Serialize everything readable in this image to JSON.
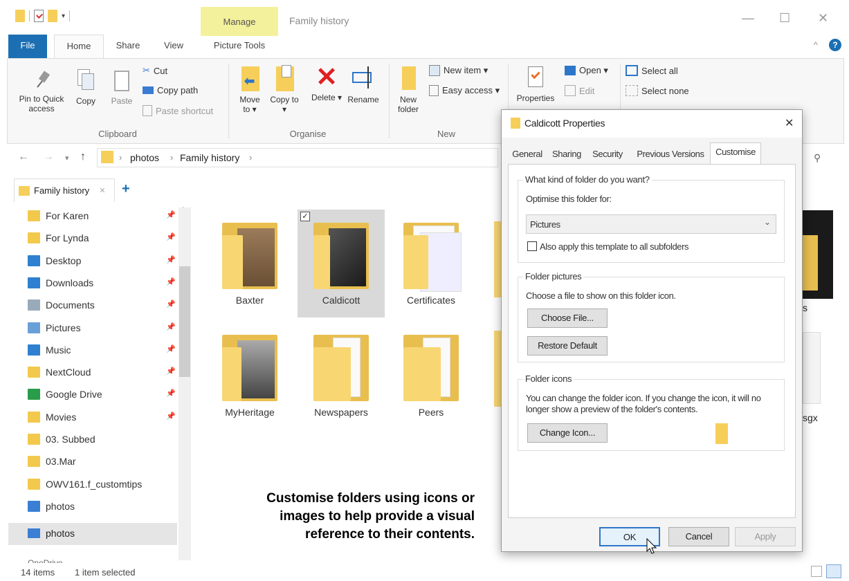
{
  "window": {
    "title": "Family history",
    "manage_tab": "Manage",
    "minimize": "—",
    "maximize": "☐",
    "close": "✕"
  },
  "tabs": {
    "file": "File",
    "home": "Home",
    "share": "Share",
    "view": "View",
    "picture_tools": "Picture Tools"
  },
  "ribbon": {
    "clipboard": {
      "pin": "Pin to Quick access",
      "copy": "Copy",
      "paste": "Paste",
      "cut": "Cut",
      "copy_path": "Copy path",
      "paste_shortcut": "Paste shortcut",
      "group": "Clipboard"
    },
    "organise": {
      "move_to": "Move to ▾",
      "copy_to": "Copy to ▾",
      "delete": "Delete ▾",
      "rename": "Rename",
      "group": "Organise"
    },
    "new": {
      "new_folder": "New folder",
      "new_item": "New item ▾",
      "easy_access": "Easy access ▾",
      "group": "New"
    },
    "open": {
      "properties": "Properties",
      "open": "Open ▾",
      "edit": "Edit"
    },
    "select": {
      "select_all": "Select all",
      "select_none": "Select none"
    }
  },
  "address": {
    "crumb1": "photos",
    "crumb2": "Family history",
    "sep": "›"
  },
  "quick_tab": {
    "label": "Family history",
    "close": "✕",
    "add": "+"
  },
  "sidebar": {
    "items": [
      {
        "label": "For Karen",
        "color": "#f2c94c",
        "pinned": "📌"
      },
      {
        "label": "For Lynda",
        "color": "#f2c94c",
        "pinned": "📌"
      },
      {
        "label": "Desktop",
        "color": "#2f80d0",
        "pinned": "📌"
      },
      {
        "label": "Downloads",
        "color": "#2f80d0",
        "pinned": "📌"
      },
      {
        "label": "Documents",
        "color": "#9ab",
        "pinned": "📌"
      },
      {
        "label": "Pictures",
        "color": "#6aa0d8",
        "pinned": "📌"
      },
      {
        "label": "Music",
        "color": "#2f80d0",
        "pinned": "📌"
      },
      {
        "label": "NextCloud",
        "color": "#f2c94c",
        "pinned": "📌"
      },
      {
        "label": "Google Drive",
        "color": "#2a9d4a",
        "pinned": "📌"
      },
      {
        "label": "Movies",
        "color": "#f2c94c",
        "pinned": "📌"
      },
      {
        "label": "03. Subbed",
        "color": "#f2c94c",
        "pinned": ""
      },
      {
        "label": "03.Mar",
        "color": "#f2c94c",
        "pinned": ""
      },
      {
        "label": "OWV161.f_customtips",
        "color": "#f2c94c",
        "pinned": ""
      },
      {
        "label": "photos",
        "color": "#3b7fd4",
        "pinned": ""
      }
    ],
    "section_photos": "photos",
    "onedrive_partial": "OneDrive"
  },
  "folders": [
    {
      "name": "Baxter"
    },
    {
      "name": "Caldicott"
    },
    {
      "name": "Certificates"
    },
    {
      "name": "MyHeritage"
    },
    {
      "name": "Newspapers"
    },
    {
      "name": "Peers"
    }
  ],
  "hidden_labels": {
    "partial_s": "s",
    "partial_sgx": "sgx"
  },
  "dialog": {
    "title": "Caldicott Properties",
    "close": "✕",
    "tabs": [
      "General",
      "Sharing",
      "Security",
      "Previous Versions",
      "Customise"
    ],
    "kind_title": "What kind of folder do you want?",
    "optimise_label": "Optimise this folder for:",
    "optimise_value": "Pictures",
    "apply_template": "Also apply this template to all subfolders",
    "pictures_title": "Folder pictures",
    "pictures_desc": "Choose a file to show on this folder icon.",
    "choose_file": "Choose File...",
    "restore_default": "Restore Default",
    "icons_title": "Folder icons",
    "icons_desc": "You can change the folder icon. If you change the icon, it will no longer show a preview of the folder's contents.",
    "change_icon": "Change Icon...",
    "ok": "OK",
    "cancel": "Cancel",
    "apply": "Apply"
  },
  "annotation": "Customise folders using icons or images to help provide a visual reference to their contents.",
  "status": {
    "items": "14 items",
    "selected": "1 item selected"
  },
  "colors": {
    "file_tab": "#1b6fb2",
    "manage_tab": "#f4f19c",
    "folder": "#f8d672"
  }
}
